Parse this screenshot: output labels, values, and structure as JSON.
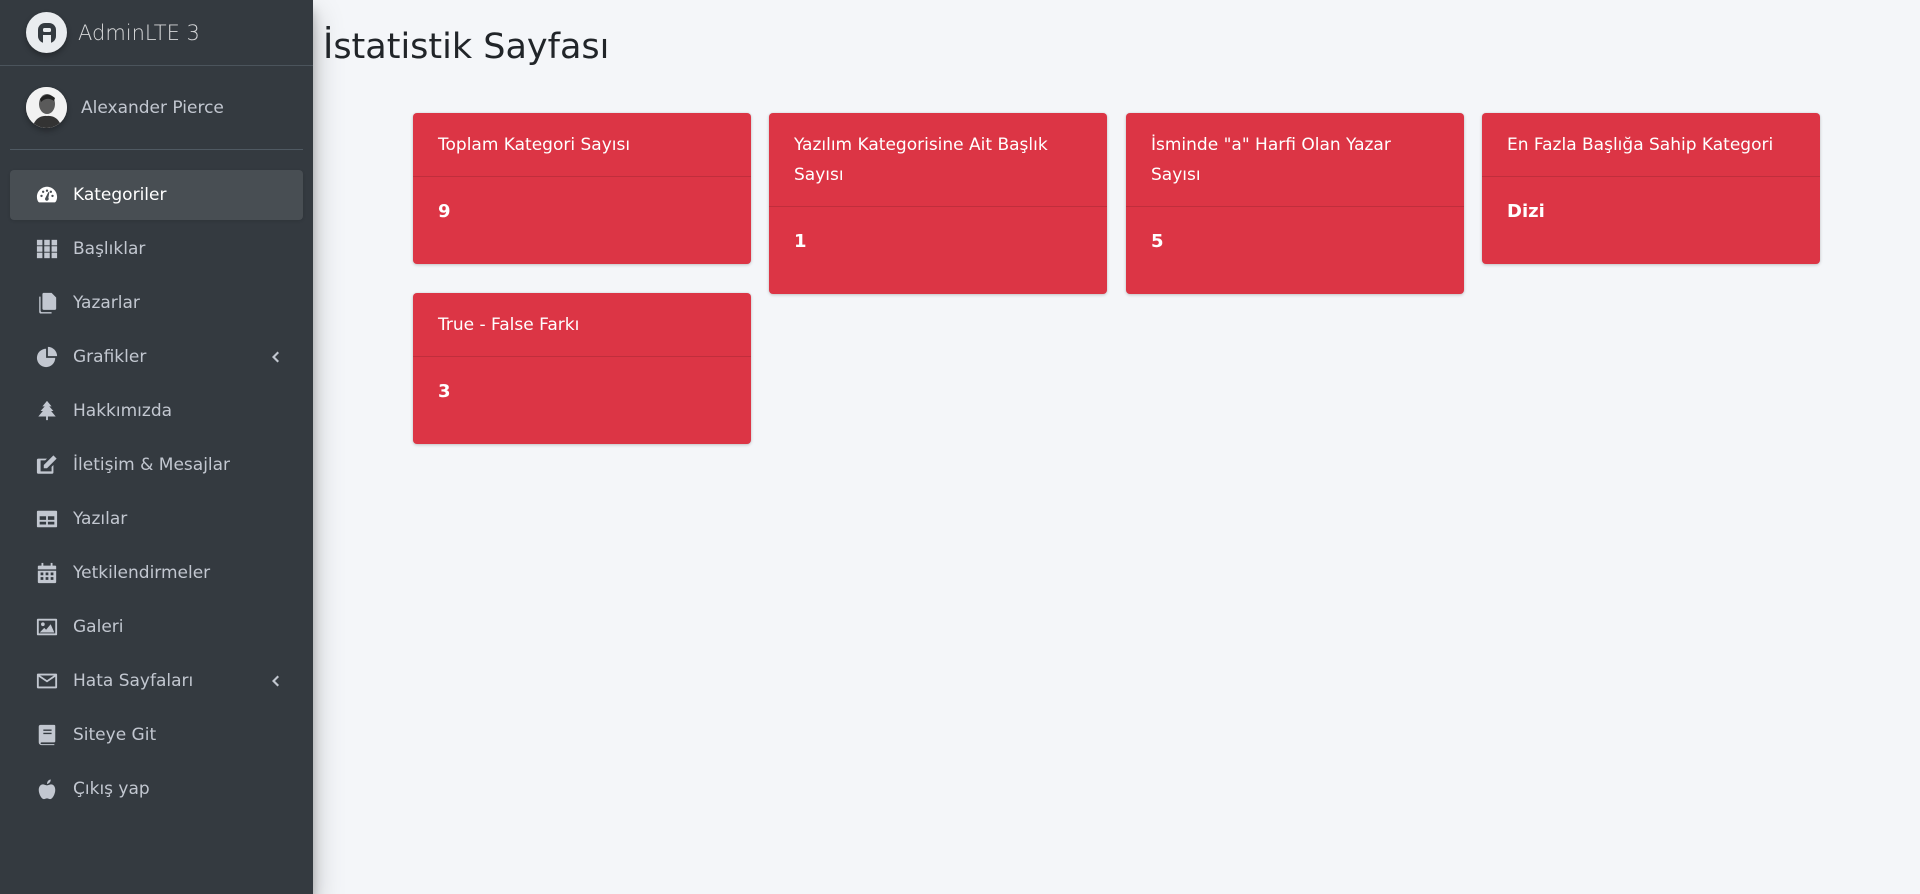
{
  "brand": {
    "name": "AdminLTE 3",
    "logo_icon": "adminlte-logo-icon"
  },
  "user": {
    "name": "Alexander Pierce",
    "avatar_icon": "user-avatar"
  },
  "sidebar": {
    "items": [
      {
        "label": "Kategoriler",
        "icon": "tachometer-icon",
        "active": true
      },
      {
        "label": "Başlıklar",
        "icon": "grid-icon"
      },
      {
        "label": "Yazarlar",
        "icon": "copy-icon"
      },
      {
        "label": "Grafikler",
        "icon": "pie-chart-icon",
        "has_submenu": true
      },
      {
        "label": "Hakkımızda",
        "icon": "tree-icon"
      },
      {
        "label": "İletişim & Mesajlar",
        "icon": "edit-icon"
      },
      {
        "label": "Yazılar",
        "icon": "table-icon"
      },
      {
        "label": "Yetkilendirmeler",
        "icon": "calendar-icon"
      },
      {
        "label": "Galeri",
        "icon": "image-icon"
      },
      {
        "label": "Hata Sayfaları",
        "icon": "envelope-icon",
        "has_submenu": true
      },
      {
        "label": "Siteye Git",
        "icon": "book-icon"
      },
      {
        "label": "Çıkış yap",
        "icon": "apple-icon"
      }
    ]
  },
  "page": {
    "title": "İstatistik Sayfası"
  },
  "cards": [
    {
      "title": "Toplam Kategori Sayısı",
      "value": "9"
    },
    {
      "title": "Yazılım Kategorisine Ait Başlık Sayısı",
      "value": "1"
    },
    {
      "title": "İsminde \"a\" Harfi Olan Yazar Sayısı",
      "value": "5"
    },
    {
      "title": "En Fazla Başlığa Sahip Kategori",
      "value": "Dizi"
    },
    {
      "title": "True - False Farkı",
      "value": "3"
    }
  ],
  "colors": {
    "sidebar_bg": "#343a40",
    "card_bg": "#dc3545",
    "content_bg": "#f4f6f9"
  }
}
